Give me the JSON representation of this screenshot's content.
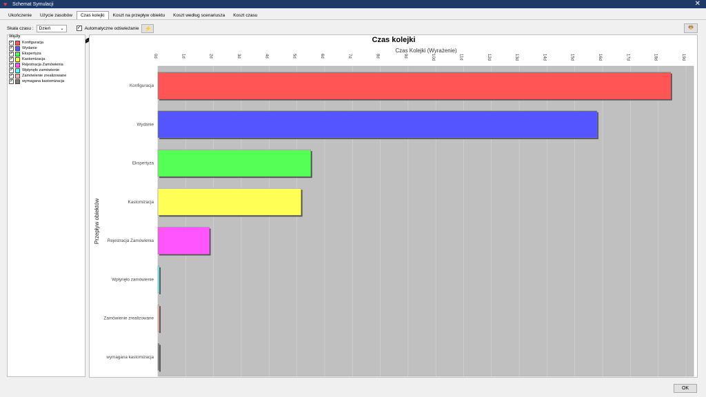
{
  "window": {
    "title": "Schemat Symulacji",
    "close_glyph": "✕",
    "icon": "heart-icon"
  },
  "tabs": [
    {
      "label": "Ukończenie"
    },
    {
      "label": "Użycie zasobów"
    },
    {
      "label": "Czas kolejki",
      "active": true
    },
    {
      "label": "Koszt na przepływ obiektu"
    },
    {
      "label": "Koszt według scenariusza"
    },
    {
      "label": "Koszt czasu"
    }
  ],
  "toolbar": {
    "scale_label": "Skala czasu :",
    "scale_value": "Dzień",
    "auto_refresh_label": "Automatyczne odświeżanie",
    "auto_refresh_checked": true
  },
  "legend": {
    "title": "Węzły",
    "items": [
      {
        "label": "Konfiguracja",
        "color": "#ff5555"
      },
      {
        "label": "Wydanie",
        "color": "#5555ff"
      },
      {
        "label": "Ekspertyza",
        "color": "#55ff55"
      },
      {
        "label": "Kastomizacja",
        "color": "#ffff55"
      },
      {
        "label": "Rejestracja Zamówienia",
        "color": "#ff55ff"
      },
      {
        "label": "Wpłynęło zamówienie",
        "color": "#55ffff"
      },
      {
        "label": "Zamówienie zrealizowane",
        "color": "#ffaaaa"
      },
      {
        "label": "wymagana kastomizacja",
        "color": "#808080"
      }
    ]
  },
  "chart_data": {
    "type": "bar",
    "orientation": "horizontal",
    "title": "Czas kolejki",
    "xlabel": "Czas Kolejki (Wyrażenie)",
    "ylabel": "Przepływ obiektów",
    "xlim": [
      0,
      19
    ],
    "x_ticks": [
      "0d",
      "1d",
      "2d",
      "3d",
      "4d",
      "5d",
      "6d",
      "7d",
      "8d",
      "9d",
      "10d",
      "11d",
      "12d",
      "13d",
      "14d",
      "15d",
      "16d",
      "17d",
      "18d",
      "19d"
    ],
    "categories": [
      "Konfiguracja",
      "Wydanie",
      "Ekspertyza",
      "Kastomizacja",
      "Rejestracja Zamówienia",
      "Wpłynęło zamówienie",
      "Zamówienie zrealizowane",
      "wymagana kastomizacja"
    ],
    "values": [
      18.45,
      15.8,
      5.5,
      5.15,
      1.85,
      0.05,
      0.05,
      0.05
    ],
    "colors": [
      "#ff5555",
      "#5555ff",
      "#55ff55",
      "#ffff55",
      "#ff55ff",
      "#55ffff",
      "#ffaaaa",
      "#808080"
    ],
    "plot_background": "#c0c0c0",
    "grid": true,
    "legend": "none"
  },
  "footer": {
    "ok_label": "OK"
  }
}
